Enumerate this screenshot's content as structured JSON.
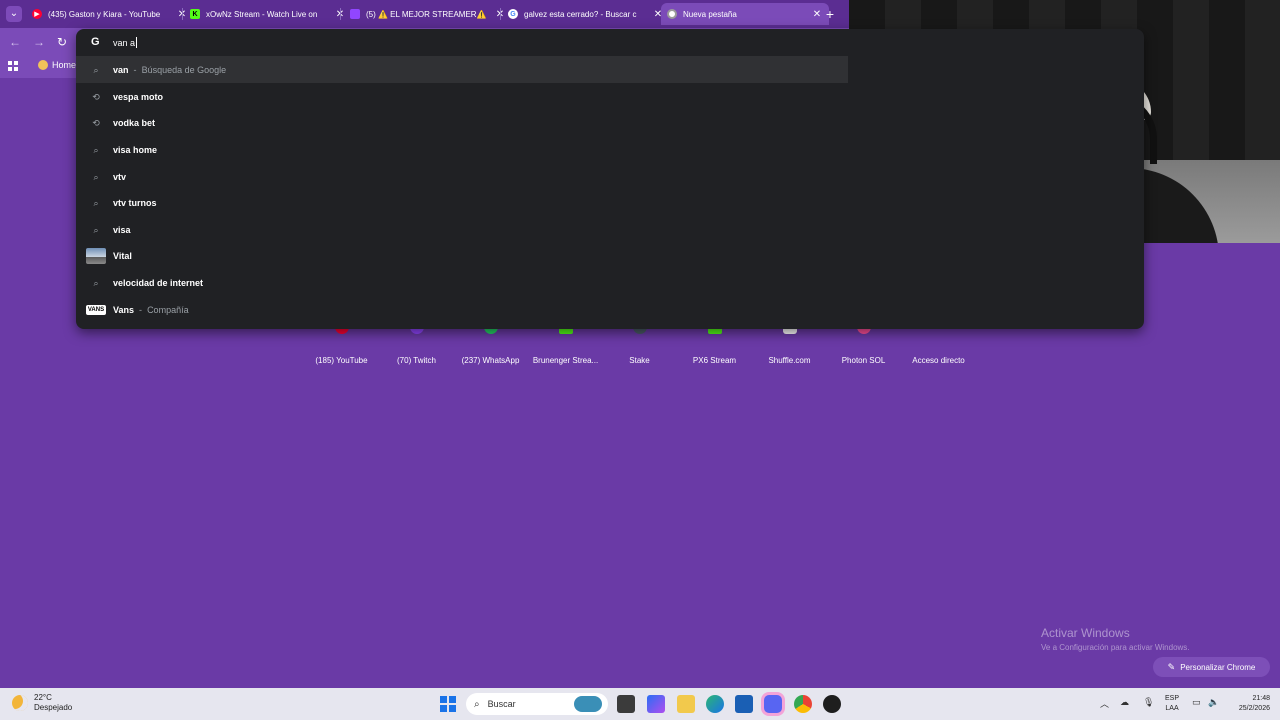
{
  "tabs": [
    {
      "title": "(435) Gaston y Kiara - YouTube",
      "favicon": "youtube-icon",
      "color": "#ff0033"
    },
    {
      "title": "xOwNz Stream - Watch Live on",
      "favicon": "kick-icon",
      "color": "#53fc18"
    },
    {
      "title": "(5) ⚠️ EL MEJOR STREAMER⚠️",
      "favicon": "twitch-icon",
      "color": "#9146ff"
    },
    {
      "title": "galvez esta cerrado? - Buscar c",
      "favicon": "google-icon",
      "color": "#4285f4"
    },
    {
      "title": "Nueva pestaña",
      "favicon": "chrome-icon",
      "color": "#ffffff"
    }
  ],
  "toolbar": {
    "bookmark_home": "Home"
  },
  "omnibox": {
    "typed": "van a",
    "google_logo": "G",
    "suggestions": [
      {
        "bold": "van",
        "sub": "Búsqueda de Google",
        "icon": "search-icon"
      },
      {
        "bold": "vespa moto",
        "sub": "",
        "icon": "history-icon"
      },
      {
        "bold": "vodka bet",
        "sub": "",
        "icon": "history-icon"
      },
      {
        "bold": "visa home",
        "sub": "",
        "icon": "search-icon"
      },
      {
        "bold": "vtv",
        "sub": "",
        "icon": "search-icon"
      },
      {
        "bold": "vtv turnos",
        "sub": "",
        "icon": "search-icon"
      },
      {
        "bold": "visa",
        "sub": "",
        "icon": "search-icon"
      },
      {
        "bold": "Vital",
        "sub": "",
        "icon": "thumbnail"
      },
      {
        "bold": "velocidad de internet",
        "sub": "",
        "icon": "search-icon"
      },
      {
        "bold": "Vans",
        "sub": "Compañía",
        "icon": "vans-logo"
      }
    ],
    "separator": "-"
  },
  "shortcuts": [
    {
      "label": "(185) YouTube",
      "color": "#ff0033"
    },
    {
      "label": "(70) Twitch",
      "color": "#9146ff"
    },
    {
      "label": "(237) WhatsApp",
      "color": "#25d366"
    },
    {
      "label": "Brunenger Strea...",
      "color": "#53fc18"
    },
    {
      "label": "Stake",
      "color": "#1a2c38"
    },
    {
      "label": "PX6 Stream",
      "color": "#53fc18"
    },
    {
      "label": "Shuffle.com",
      "color": "#ffffff"
    },
    {
      "label": "Photon SOL",
      "color": "#ff4f9a"
    },
    {
      "label": "Acceso directo",
      "color": "#7b4bb8"
    }
  ],
  "watermark": {
    "line1": "Activar Windows",
    "line2": "Ve a Configuración para activar Windows."
  },
  "customize_label": "Personalizar Chrome",
  "taskbar": {
    "temperature": "22°C",
    "weather": "Despejado",
    "search_label": "Buscar",
    "lang1": "ESP",
    "lang2": "LAA",
    "time": "21:48",
    "date": "25/2/2026"
  }
}
